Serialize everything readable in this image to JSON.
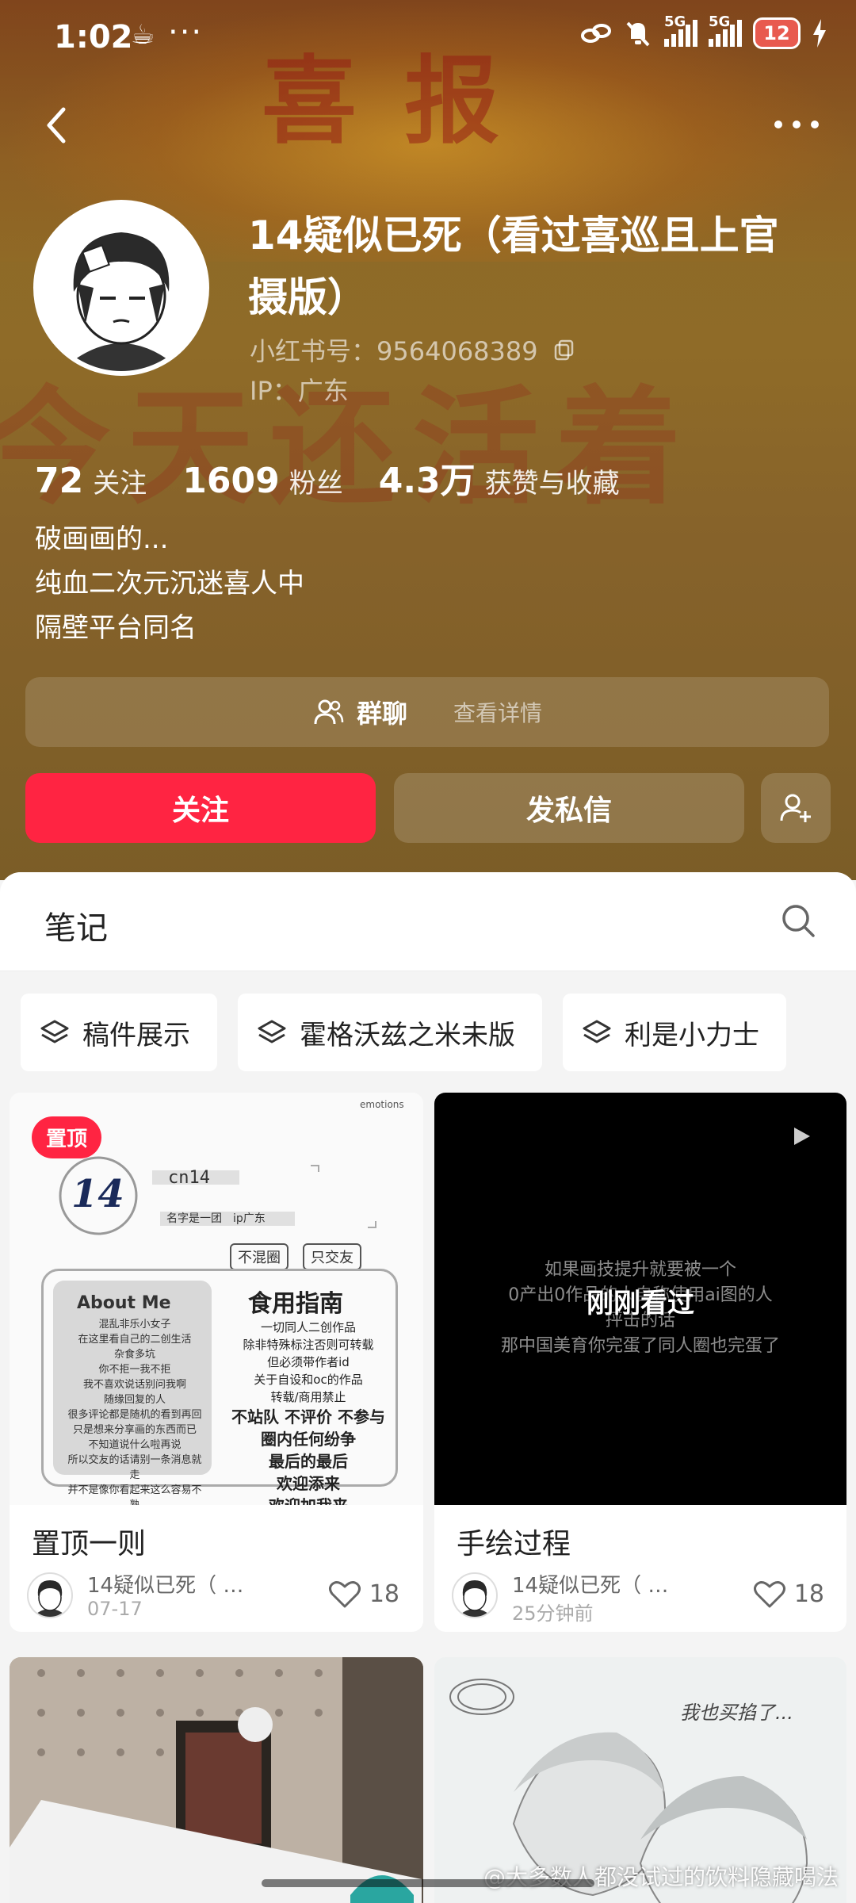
{
  "status_bar": {
    "time": "1:02",
    "extra": "☕",
    "dots": "···",
    "network_1": "5G",
    "network_2": "5G",
    "battery": "12"
  },
  "banner": {
    "top_text": "喜报",
    "bg_text": "今天还活着"
  },
  "profile": {
    "name": "14疑似已死（看过喜巡且上官摄版）",
    "rid_label": "小红书号：",
    "rid": "9564068389",
    "ip_label": "IP：",
    "ip": "广东",
    "stats": [
      {
        "num": "72",
        "label": "关注"
      },
      {
        "num": "1609",
        "label": "粉丝"
      },
      {
        "num": "4.3万",
        "label": "获赞与收藏"
      }
    ],
    "bio": [
      "破画画的...",
      "纯血二次元沉迷喜人中",
      "隔壁平台同名"
    ]
  },
  "group": {
    "label": "群聊",
    "detail": "查看详情"
  },
  "actions": {
    "follow": "关注",
    "message": "发私信"
  },
  "notes": {
    "title": "笔记",
    "chips": [
      "稿件展示",
      "霍格沃兹之米未版",
      "利是小力士"
    ]
  },
  "cards": [
    {
      "pinned": "置顶",
      "title": "置顶一则",
      "author": "14疑似已死（ …",
      "time": "07-17",
      "likes": "18",
      "thumb": {
        "num": "14",
        "handle": "cn14",
        "sub": "名字是一团　ip广东",
        "emotions": "emotions",
        "tag1": "不混圈",
        "tag2": "只交友",
        "about_title": "About Me",
        "about_lines": [
          "混乱非乐小女子",
          "在这里看自己的二创生活",
          "杂食多坑",
          "你不拒一我不拒",
          "我不喜欢说话别问我啊",
          "随缘回复的人",
          "很多评论都是随机的看到再回",
          "只是想来分享画的东西而已",
          "不知道说什么啦再说",
          "所以交友的话请别一条消息就走",
          "并不是像你看起来这么容易不熟"
        ],
        "guide_title": "食用指南",
        "guide_lines": [
          "一切同人二创作品",
          "除非特殊标注否则可转载",
          "但必须带作者id",
          "关于自设和oc的作品",
          "转载/商用禁止"
        ],
        "guide_bold": [
          "不站队 不评价 不参与",
          "圈内任何纷争",
          "最后的最后",
          "欢迎添来",
          "欢迎加我来"
        ]
      }
    },
    {
      "title": "手绘过程",
      "author": "14疑似已死（ …",
      "time": "25分钟前",
      "likes": "18",
      "video_lines": [
        "如果画技提升就要被一个",
        "0产出0作品的人自称使用ai图的人",
        "抨击的话",
        "那中国美育你完蛋了同人圈也完蛋了"
      ],
      "overlay": "刚刚看过"
    },
    {
      "title": ""
    },
    {
      "title": "",
      "handwriting": "我也买掐了..."
    }
  ],
  "watermark": "@大多数人都没试过的饮料隐藏喝法",
  "colors": {
    "accent": "#ff2442",
    "header_bg": "#8d6a26"
  }
}
